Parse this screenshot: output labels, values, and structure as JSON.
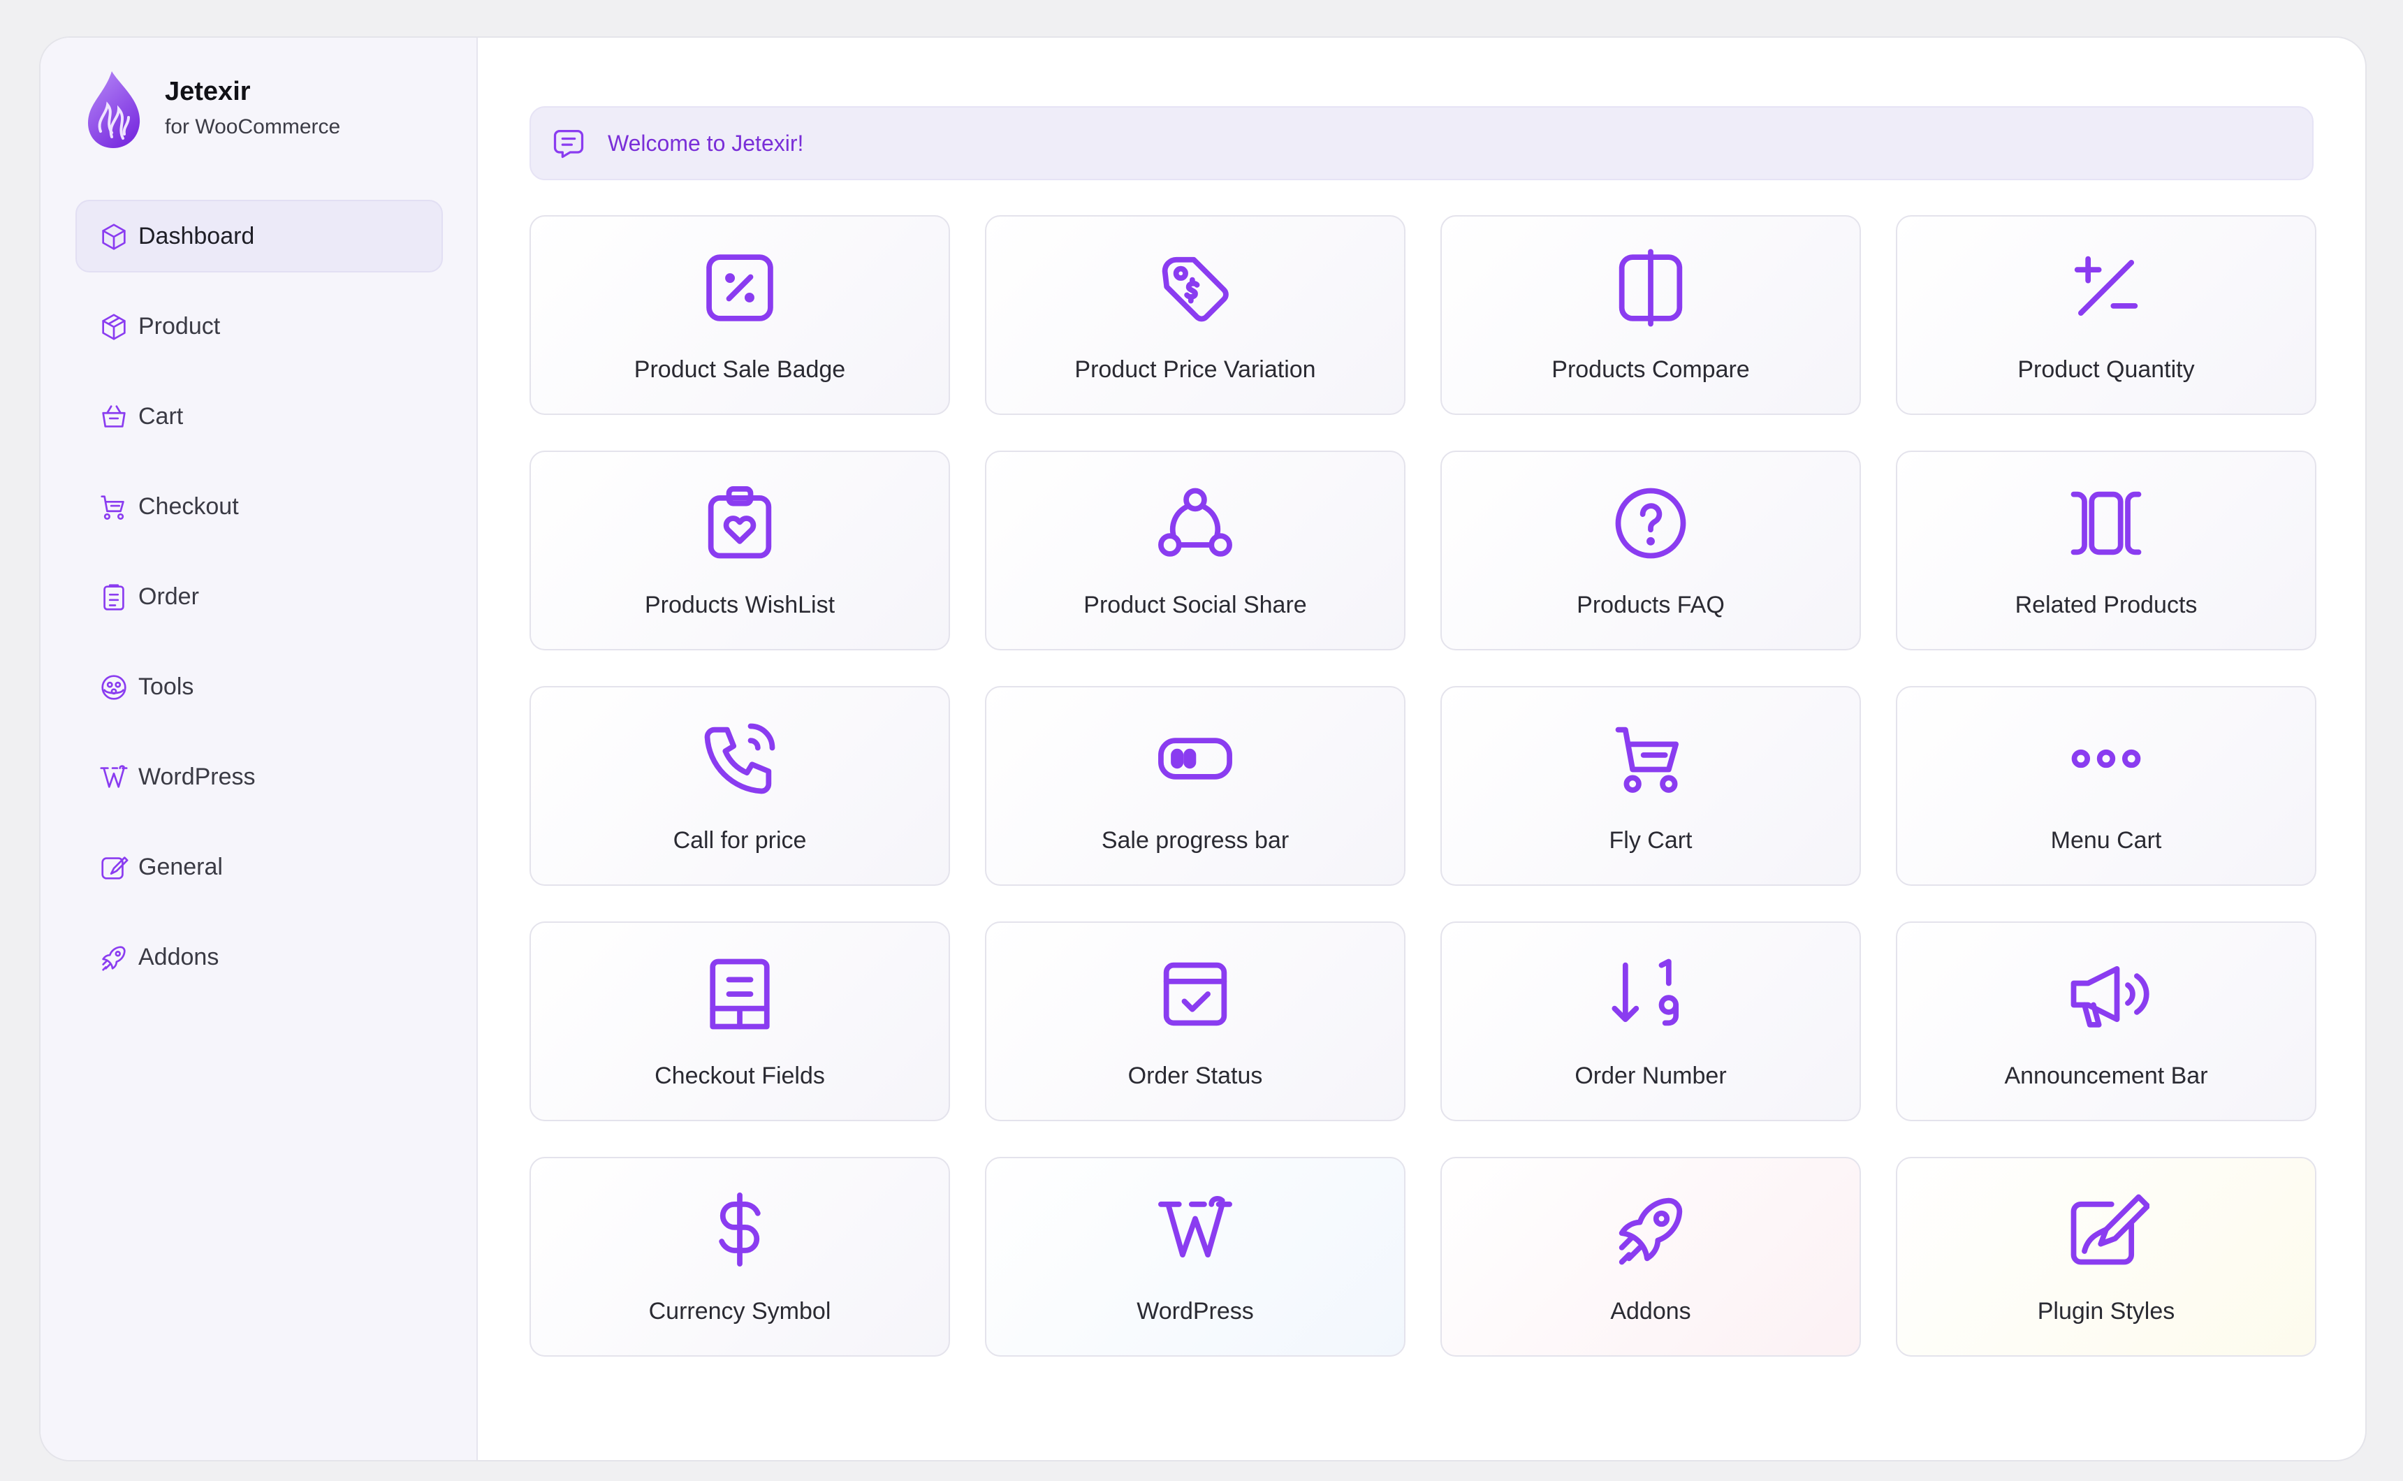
{
  "brand": {
    "name": "Jetexir",
    "subtitle": "for WooCommerce"
  },
  "colors": {
    "accent": "#8a3cf0",
    "sidebar_bg": "#f6f5fb",
    "active_bg": "#eceaf8",
    "welcome_bg": "#efedf9",
    "welcome_text": "#7a2fd8"
  },
  "sidebar": {
    "items": [
      {
        "label": "Dashboard",
        "icon": "cube-icon",
        "active": true
      },
      {
        "label": "Product",
        "icon": "box-icon"
      },
      {
        "label": "Cart",
        "icon": "basket-icon"
      },
      {
        "label": "Checkout",
        "icon": "cart-icon"
      },
      {
        "label": "Order",
        "icon": "clipboard-list-icon"
      },
      {
        "label": "Tools",
        "icon": "tools-icon"
      },
      {
        "label": "WordPress",
        "icon": "wordpress-icon"
      },
      {
        "label": "General",
        "icon": "edit-icon"
      },
      {
        "label": "Addons",
        "icon": "rocket-icon"
      }
    ]
  },
  "welcome": {
    "message": "Welcome to Jetexir!",
    "icon": "message-icon"
  },
  "modules": [
    {
      "label": "Product Sale Badge",
      "icon": "discount-icon"
    },
    {
      "label": "Product Price Variation",
      "icon": "price-tag-icon"
    },
    {
      "label": "Products Compare",
      "icon": "compare-icon"
    },
    {
      "label": "Product Quantity",
      "icon": "plus-minus-icon"
    },
    {
      "label": "Products WishList",
      "icon": "wishlist-icon"
    },
    {
      "label": "Product Social Share",
      "icon": "social-share-icon"
    },
    {
      "label": "Products FAQ",
      "icon": "question-icon"
    },
    {
      "label": "Related Products",
      "icon": "carousel-icon"
    },
    {
      "label": "Call for price",
      "icon": "phone-call-icon"
    },
    {
      "label": "Sale progress bar",
      "icon": "progress-icon"
    },
    {
      "label": "Fly Cart",
      "icon": "cart-icon"
    },
    {
      "label": "Menu Cart",
      "icon": "dots-icon"
    },
    {
      "label": "Checkout Fields",
      "icon": "receipt-icon"
    },
    {
      "label": "Order Status",
      "icon": "calendar-check-icon"
    },
    {
      "label": "Order Number",
      "icon": "sort-numeric-icon"
    },
    {
      "label": "Announcement Bar",
      "icon": "speakerphone-icon"
    },
    {
      "label": "Currency Symbol",
      "icon": "dollar-icon",
      "tint": ""
    },
    {
      "label": "WordPress",
      "icon": "wordpress-icon",
      "tint": "blue"
    },
    {
      "label": "Addons",
      "icon": "rocket-icon",
      "tint": "pink"
    },
    {
      "label": "Plugin Styles",
      "icon": "brush-icon",
      "tint": "yellow"
    }
  ]
}
